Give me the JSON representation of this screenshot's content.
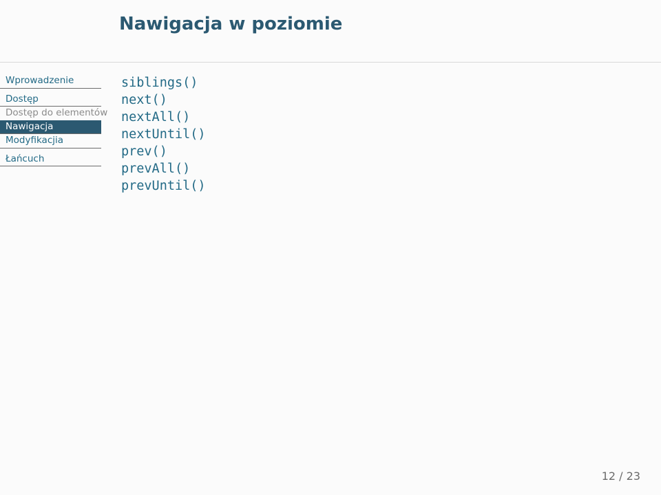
{
  "title": "Nawigacja w poziomie",
  "nav": {
    "items": [
      {
        "label": "Wprowadzenie",
        "kind": "link"
      },
      {
        "label": "Dostęp",
        "kind": "link"
      },
      {
        "label": "Dostęp do elementów",
        "kind": "sub"
      },
      {
        "label": "Nawigacja",
        "kind": "active"
      },
      {
        "label": "Modyfikacjia",
        "kind": "link"
      },
      {
        "label": "Łańcuch",
        "kind": "link"
      }
    ]
  },
  "content": {
    "lines": [
      "siblings()",
      "next()",
      "nextAll()",
      "nextUntil()",
      "prev()",
      "prevAll()",
      "prevUntil()"
    ]
  },
  "pager": {
    "current": "12",
    "sep": " / ",
    "total": "23"
  }
}
